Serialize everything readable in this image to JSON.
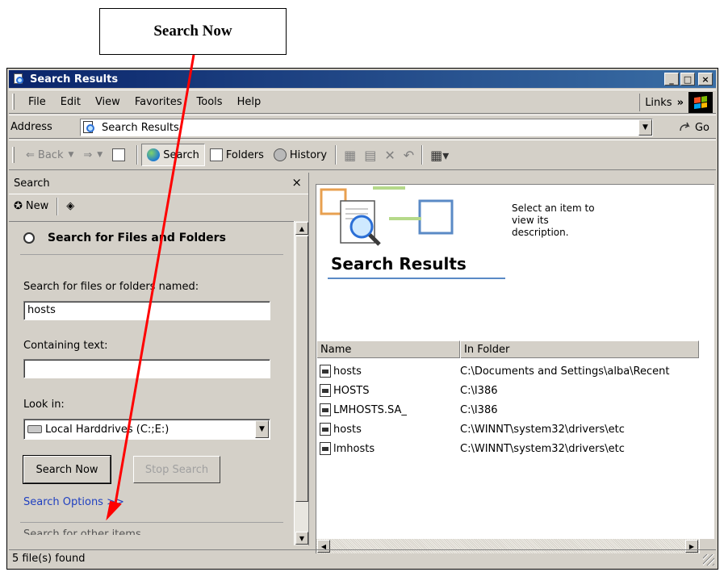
{
  "callout": {
    "label": "Search Now"
  },
  "window": {
    "title": "Search Results",
    "title_buttons": {
      "minimize": "_",
      "maximize": "□",
      "close": "×"
    }
  },
  "menubar": {
    "items": [
      "File",
      "Edit",
      "View",
      "Favorites",
      "Tools",
      "Help"
    ],
    "links_label": "Links",
    "links_chevron": "»"
  },
  "addressbar": {
    "label": "Address",
    "value": "Search Results",
    "go_label": "Go"
  },
  "toolbar": {
    "back_label": "Back",
    "search_label": "Search",
    "folders_label": "Folders",
    "history_label": "History"
  },
  "search_pane": {
    "header": "Search",
    "close_glyph": "×",
    "new_label": "New",
    "section_title": "Search for Files and Folders",
    "named_label": "Search for files or folders named:",
    "named_value": "hosts",
    "containing_label": "Containing text:",
    "containing_value": "",
    "lookin_label": "Look in:",
    "lookin_value": "Local Harddrives (C:;E:)",
    "search_now_button": "Search Now",
    "stop_search_button": "Stop Search",
    "options_link": "Search Options >>",
    "partial_next": "Search for other items"
  },
  "results_pane": {
    "title": "Search Results",
    "description": "Select an item to view its description.",
    "columns": [
      "Name",
      "In Folder"
    ],
    "rows": [
      {
        "name": "hosts",
        "folder": "C:\\Documents and Settings\\alba\\Recent"
      },
      {
        "name": "HOSTS",
        "folder": "C:\\I386"
      },
      {
        "name": "LMHOSTS.SA_",
        "folder": "C:\\I386"
      },
      {
        "name": "hosts",
        "folder": "C:\\WINNT\\system32\\drivers\\etc"
      },
      {
        "name": "lmhosts",
        "folder": "C:\\WINNT\\system32\\drivers\\etc"
      }
    ]
  },
  "statusbar": {
    "text": "5 file(s) found"
  },
  "colors": {
    "titlebar": "#0a246a",
    "annotation_arrow": "#ff0000",
    "link": "#2040c0"
  }
}
